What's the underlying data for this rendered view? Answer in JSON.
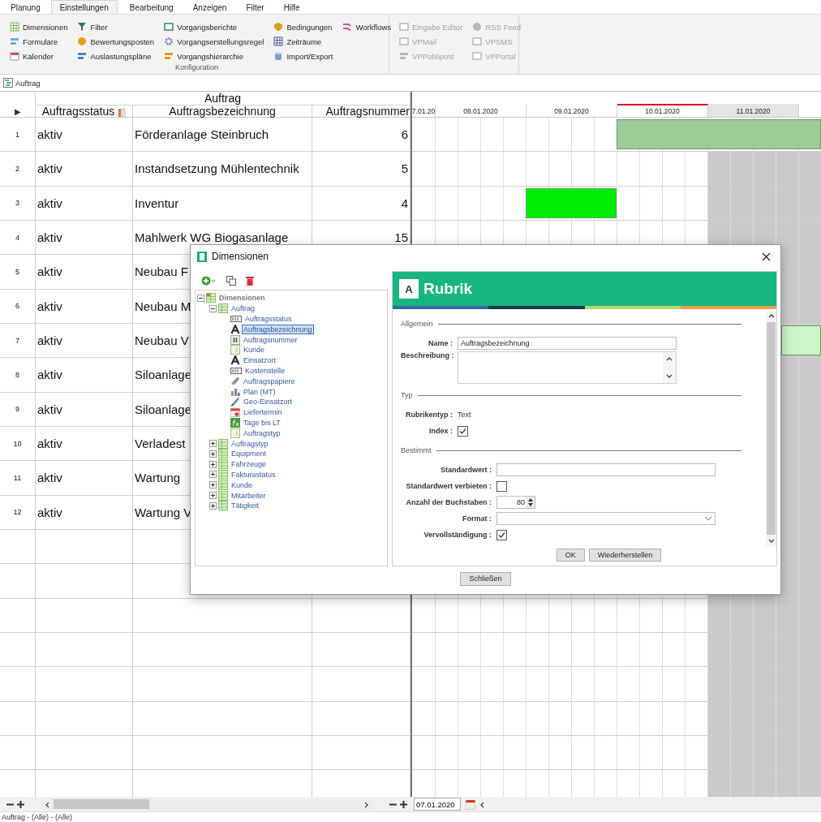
{
  "ribbon": {
    "tabs": [
      {
        "label": "Planung",
        "selected": false
      },
      {
        "label": "Einstellungen",
        "selected": true
      },
      {
        "label": "Bearbeitung",
        "selected": false
      },
      {
        "label": "Anzeigen",
        "selected": false
      },
      {
        "label": "Filter",
        "selected": false
      },
      {
        "label": "Hilfe",
        "selected": false
      }
    ],
    "groups": [
      {
        "label": "Konfiguration",
        "columns": [
          [
            {
              "label": "Dimensionen",
              "disabled": false
            },
            {
              "label": "Formulare",
              "disabled": false
            },
            {
              "label": "Kalender",
              "disabled": false
            }
          ],
          [
            {
              "label": "Filter",
              "disabled": false
            },
            {
              "label": "Bewertungsposten",
              "disabled": false
            },
            {
              "label": "Auslastungspläne",
              "disabled": false
            }
          ],
          [
            {
              "label": "Vorgangsberichte",
              "disabled": false
            },
            {
              "label": "Vorgangserstellungsregel",
              "disabled": false
            },
            {
              "label": "Vorgangshierarchie",
              "disabled": false
            }
          ],
          [
            {
              "label": "Bedingungen",
              "disabled": false
            },
            {
              "label": "Zeiträume",
              "disabled": false
            },
            {
              "label": "Import/Export",
              "disabled": false
            }
          ],
          [
            {
              "label": "Workflows",
              "disabled": false
            }
          ]
        ]
      },
      {
        "columns": [
          [
            {
              "label": "Eingabe Editor",
              "disabled": true
            },
            {
              "label": "VPMail",
              "disabled": true
            },
            {
              "label": "VPPublipost",
              "disabled": true
            }
          ],
          [
            {
              "label": "RSS Feed",
              "disabled": true
            },
            {
              "label": "VPSMS",
              "disabled": true
            },
            {
              "label": "VPPortal",
              "disabled": true
            }
          ]
        ]
      }
    ]
  },
  "document_tab": {
    "label": "Auftrag"
  },
  "table": {
    "group_header": "Auftrag",
    "row_marker": "▶",
    "columns": [
      "Auftragsstatus",
      "Auftragsbezeichnung",
      "Auftragsnummer"
    ],
    "rows": [
      {
        "number": "1",
        "status": "aktiv",
        "name": "Förderanlage Steinbruch",
        "order_no": "6"
      },
      {
        "number": "2",
        "status": "aktiv",
        "name": "Instandsetzung Mühlentechnik",
        "order_no": "5"
      },
      {
        "number": "3",
        "status": "aktiv",
        "name": "Inventur",
        "order_no": "4"
      },
      {
        "number": "4",
        "status": "aktiv",
        "name": "Mahlwerk WG Biogasanlage",
        "order_no": "15"
      },
      {
        "number": "5",
        "status": "aktiv",
        "name": "Neubau F"
      },
      {
        "number": "6",
        "status": "aktiv",
        "name": "Neubau M"
      },
      {
        "number": "7",
        "status": "aktiv",
        "name": "Neubau V"
      },
      {
        "number": "8",
        "status": "aktiv",
        "name": "Siloanlage"
      },
      {
        "number": "9",
        "status": "aktiv",
        "name": "Siloanlage"
      },
      {
        "number": "10",
        "status": "aktiv",
        "name": "Verladest"
      },
      {
        "number": "11",
        "status": "aktiv",
        "name": "Wartung"
      },
      {
        "number": "12",
        "status": "aktiv",
        "name": "Wartung V"
      }
    ]
  },
  "gantt": {
    "days": [
      {
        "label": "7.01.20",
        "today": false,
        "weekend": false
      },
      {
        "label": "08.01.2020",
        "today": false,
        "weekend": false
      },
      {
        "label": "09.01.2020",
        "today": false,
        "weekend": false
      },
      {
        "label": "10.01.2020",
        "today": true,
        "weekend": false
      },
      {
        "label": "11.01.2020",
        "today": false,
        "weekend": true
      }
    ],
    "bars": [
      {
        "color": "#9ccc98"
      },
      {
        "color": "#00ee00"
      },
      {
        "color": "#ccf5cc"
      }
    ]
  },
  "dialog": {
    "title": "Dimensionen",
    "tree": {
      "label": "Dimensionen",
      "kind": "root",
      "expanded": true,
      "selected": false,
      "children": [
        {
          "label": "Auftrag",
          "kind": "table",
          "expanded": true,
          "selected": false,
          "children": [
            {
              "label": "Auftragsstatus",
              "kind": "list",
              "selected": false
            },
            {
              "label": "Auftragsbezeichnung",
              "kind": "text",
              "selected": true
            },
            {
              "label": "Auftragsnummer",
              "kind": "number",
              "selected": false
            },
            {
              "label": "Kunde",
              "kind": "reference",
              "selected": false
            },
            {
              "label": "Einsatzort",
              "kind": "text",
              "selected": false
            },
            {
              "label": "Kostenstelle",
              "kind": "list",
              "selected": false
            },
            {
              "label": "Auftragspapiere",
              "kind": "file",
              "selected": false
            },
            {
              "label": "Plan  (MT)",
              "kind": "chart",
              "selected": false
            },
            {
              "label": "Geo-Einsatzort",
              "kind": "geo",
              "selected": false
            },
            {
              "label": "Liefertermin",
              "kind": "date",
              "selected": false
            },
            {
              "label": "Tage bis LT",
              "kind": "formula",
              "selected": false
            },
            {
              "label": "Auftragstyp",
              "kind": "reference",
              "selected": false
            }
          ]
        },
        {
          "label": "Auftragstyp",
          "kind": "table",
          "expanded": false,
          "selected": false
        },
        {
          "label": "Equipment",
          "kind": "table",
          "expanded": false,
          "selected": false
        },
        {
          "label": "Fahrzeuge",
          "kind": "table",
          "expanded": false,
          "selected": false
        },
        {
          "label": "Fakturastatus",
          "kind": "table",
          "expanded": false,
          "selected": false
        },
        {
          "label": "Kunde",
          "kind": "table",
          "expanded": false,
          "selected": false
        },
        {
          "label": "Mitarbeiter",
          "kind": "table",
          "expanded": false,
          "selected": false
        },
        {
          "label": "Tätigkeit",
          "kind": "table",
          "expanded": false,
          "selected": false
        }
      ]
    },
    "panel": {
      "badge": "A",
      "title": "Rubrik",
      "sections": [
        {
          "title": "Allgemein",
          "fields": [
            {
              "kind": "text",
              "label": "Name :",
              "value": "Auftragsbezeichnung"
            },
            {
              "kind": "textarea",
              "label": "Beschreibung :"
            }
          ]
        },
        {
          "title": "Typ",
          "fields": [
            {
              "kind": "static",
              "label": "Rubrikentyp :",
              "value": "Text"
            },
            {
              "kind": "checkbox",
              "label": "Index :",
              "checked": true
            }
          ]
        },
        {
          "title": "Bestimmt",
          "fields": [
            {
              "kind": "text",
              "label": "Standardwert :"
            },
            {
              "kind": "checkbox",
              "label": "Standardwert verbieten :",
              "checked": false
            },
            {
              "kind": "spinner",
              "label": "Anzahl der Buchstaben :",
              "value": "80"
            },
            {
              "kind": "dropdown",
              "label": "Format :"
            },
            {
              "kind": "checkbox",
              "label": "Vervollständigung :",
              "checked": true
            }
          ]
        }
      ],
      "buttons": [
        "OK",
        "Wiederherstellen"
      ]
    },
    "close_button": "Schließen"
  },
  "bottom_bar": {
    "date": "07.01.2020"
  },
  "status_bar": "Auftrag - (Alle) - (Alle)"
}
